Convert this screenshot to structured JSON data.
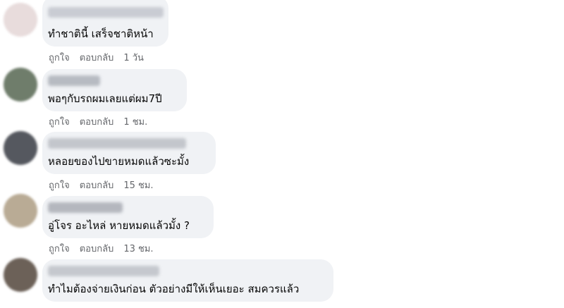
{
  "comments": [
    {
      "text": "ทำชาตินี้ เสร็จชาติหน้า",
      "like_label": "ถูกใจ",
      "reply_label": "ตอบกลับ",
      "time": "1 วัน",
      "avatar_color": "#e8dcdc",
      "name_blur_color": "#c9ccd3"
    },
    {
      "text": "พอๆกับรถผมเลยแต่ผม7ปี",
      "like_label": "ถูกใจ",
      "reply_label": "ตอบกลับ",
      "time": "1 ชม.",
      "avatar_color": "#6f7d6b",
      "name_blur_color": "#b7bbc2"
    },
    {
      "text": "หลอยของไปขายหมดแล้วซะมั้ง",
      "like_label": "ถูกใจ",
      "reply_label": "ตอบกลับ",
      "time": "15 ชม.",
      "avatar_color": "#55585f",
      "name_blur_color": "#c3c6cc"
    },
    {
      "text": "อู่โจร อะไหล่ หายหมดแล้วมั้ง ?",
      "like_label": "ถูกใจ",
      "reply_label": "ตอบกลับ",
      "time": "13 ชม.",
      "avatar_color": "#b9ab95",
      "name_blur_color": "#b4b7be"
    },
    {
      "text": "ทำไมต้องจ่ายเงินก่อน ตัวอย่างมีให้เห็นเยอะ สมควรแล้ว",
      "avatar_color": "#6c6158",
      "name_blur_color": "#c5c8ce"
    }
  ]
}
